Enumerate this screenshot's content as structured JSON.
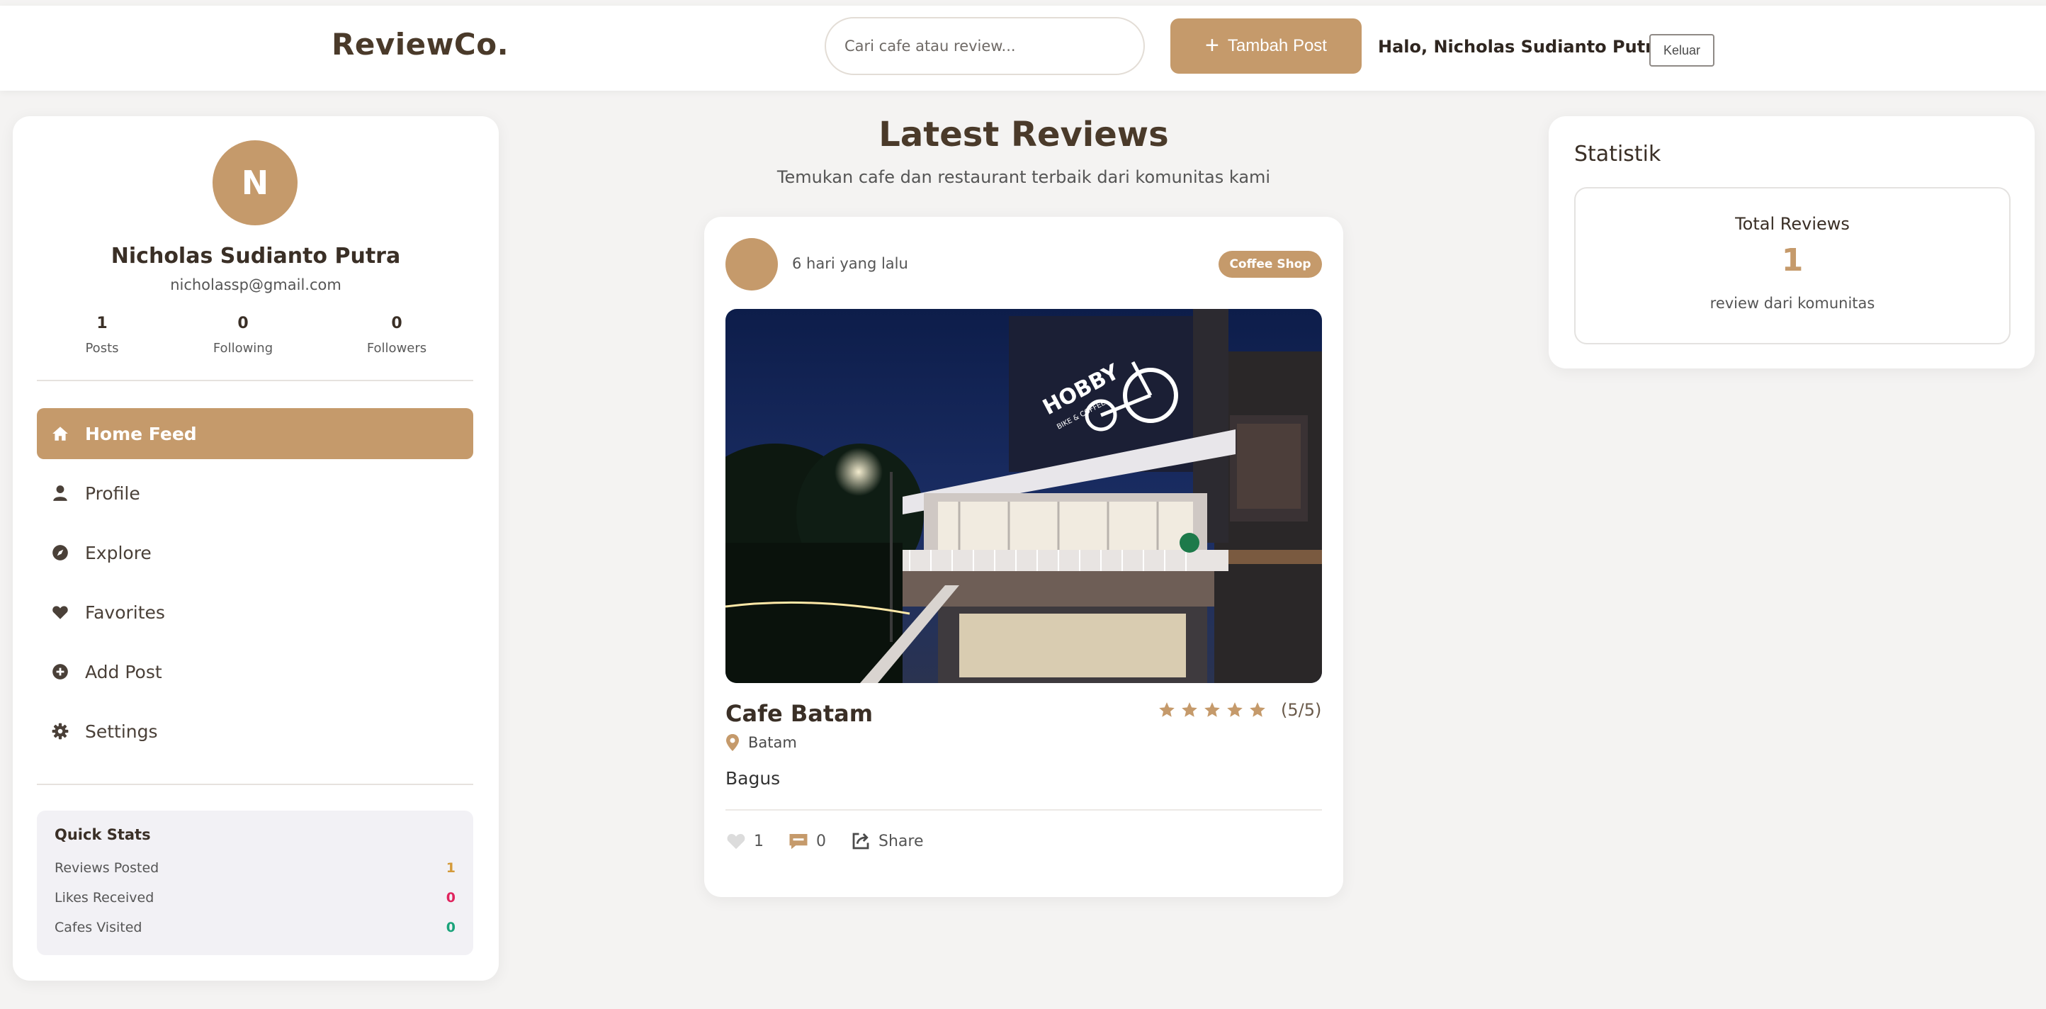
{
  "brand": "ReviewCo.",
  "search": {
    "placeholder": "Cari cafe atau review..."
  },
  "header": {
    "add_post_label": "Tambah Post",
    "greeting": "Halo, Nicholas Sudianto Putra",
    "logout_label": "Keluar"
  },
  "profile": {
    "initial": "N",
    "name": "Nicholas Sudianto Putra",
    "email": "nicholassp@gmail.com",
    "stats": [
      {
        "value": "1",
        "label": "Posts"
      },
      {
        "value": "0",
        "label": "Following"
      },
      {
        "value": "0",
        "label": "Followers"
      }
    ]
  },
  "nav": [
    {
      "label": "Home Feed",
      "icon": "home-icon",
      "active": true
    },
    {
      "label": "Profile",
      "icon": "user-icon",
      "active": false
    },
    {
      "label": "Explore",
      "icon": "compass-icon",
      "active": false
    },
    {
      "label": "Favorites",
      "icon": "heart-icon",
      "active": false
    },
    {
      "label": "Add Post",
      "icon": "plus-circle-icon",
      "active": false
    },
    {
      "label": "Settings",
      "icon": "gear-icon",
      "active": false
    }
  ],
  "quick_stats": {
    "title": "Quick Stats",
    "items": [
      {
        "label": "Reviews Posted",
        "value": "1",
        "color": "#d49a3a"
      },
      {
        "label": "Likes Received",
        "value": "0",
        "color": "#e0245e"
      },
      {
        "label": "Cafes Visited",
        "value": "0",
        "color": "#1aa37a"
      }
    ]
  },
  "feed": {
    "title": "Latest Reviews",
    "subtitle": "Temukan cafe dan restaurant terbaik dari komunitas kami"
  },
  "post": {
    "time": "6 hari yang lalu",
    "category": "Coffee Shop",
    "cafe_name": "Cafe Batam",
    "rating_text": "(5/5)",
    "rating": 5,
    "location": "Batam",
    "review": "Bagus",
    "likes": "1",
    "comments": "0",
    "share_label": "Share",
    "image_sign": "HOBBY",
    "image_sign_sub": "BIKE & COFFEE"
  },
  "statistics": {
    "title": "Statistik",
    "box_title": "Total Reviews",
    "count": "1",
    "caption": "review dari komunitas"
  },
  "colors": {
    "accent": "#c59a6b",
    "heading": "#4a3a2a"
  }
}
